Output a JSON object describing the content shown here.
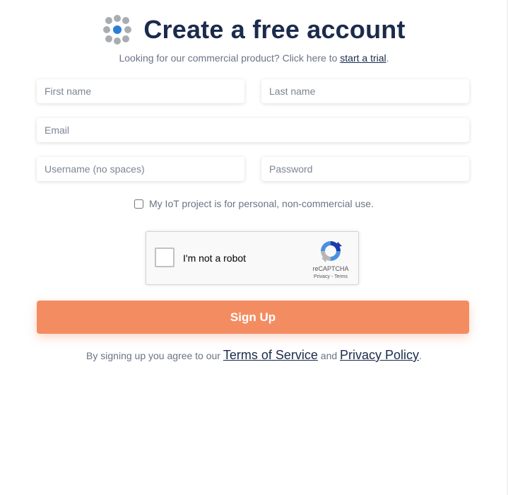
{
  "header": {
    "logo_icon": "dots-grid-logo-icon",
    "title": "Create a free account"
  },
  "subtitle": {
    "text_before": "Looking for our commercial product? Click here to ",
    "link": "start a trial",
    "text_after": "."
  },
  "form": {
    "first_name": {
      "placeholder": "First name",
      "value": ""
    },
    "last_name": {
      "placeholder": "Last name",
      "value": ""
    },
    "email": {
      "placeholder": "Email",
      "value": ""
    },
    "username": {
      "placeholder": "Username (no spaces)",
      "value": ""
    },
    "password": {
      "placeholder": "Password",
      "value": ""
    },
    "personal_use": {
      "label": "My IoT project is for personal, non-commercial use.",
      "checked": false
    }
  },
  "recaptcha": {
    "label": "I'm not a robot",
    "brand": "reCAPTCHA",
    "privacy": "Privacy",
    "separator": " - ",
    "terms": "Terms"
  },
  "submit": {
    "label": "Sign Up"
  },
  "agreement": {
    "text_before": "By signing up you agree to our ",
    "terms_link": "Terms of Service",
    "text_middle": " and ",
    "privacy_link": "Privacy Policy",
    "text_after": "."
  },
  "colors": {
    "title": "#1b2b4b",
    "accent": "#f48c62",
    "logo_blue": "#2a7fd4",
    "logo_gray": "#a9adb3"
  }
}
